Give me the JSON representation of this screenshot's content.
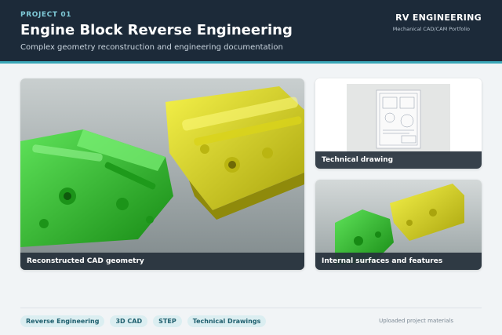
{
  "header": {
    "project_label": "PROJECT 01",
    "title": "Engine Block Reverse Engineering",
    "subtitle": "Complex geometry reconstruction and engineering documentation",
    "brand_name": "RV ENGINEERING",
    "brand_tagline": "Mechanical CAD/CAM Portfolio"
  },
  "gallery": {
    "main_caption": "Reconstructed CAD geometry",
    "drawing_caption": "Technical drawing",
    "internal_caption": "Internal surfaces and features"
  },
  "tags": [
    "Reverse Engineering",
    "3D CAD",
    "STEP",
    "Technical Drawings"
  ],
  "footer": {
    "note": "Uploaded project materials"
  },
  "colors": {
    "header_bg": "#1c2a39",
    "accent": "#3aa7b8",
    "cad_green": "#2ab526",
    "cad_yellow": "#e6e21e"
  }
}
